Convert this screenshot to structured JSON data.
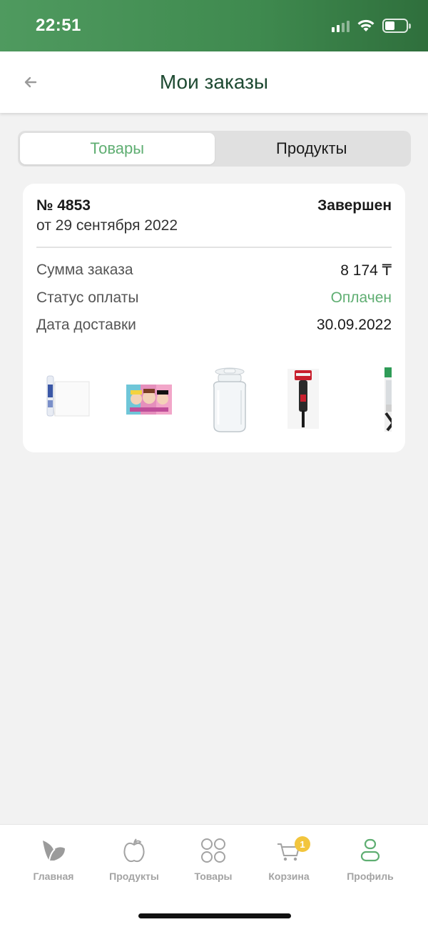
{
  "status_bar": {
    "time": "22:51"
  },
  "header": {
    "title": "Мои заказы",
    "back_icon": "arrow-left-icon"
  },
  "tabs": [
    {
      "label": "Товары",
      "active": true
    },
    {
      "label": "Продукты",
      "active": false
    }
  ],
  "order": {
    "number": "№ 4853",
    "date": "от 29 сентября 2022",
    "status": "Завершен",
    "rows": {
      "sum_label": "Сумма заказа",
      "sum_value": "8 174 ₸",
      "payment_label": "Статус оплаты",
      "payment_value": "Оплачен",
      "delivery_label": "Дата доставки",
      "delivery_value": "30.09.2022"
    },
    "items": [
      "baking-paper-roll",
      "lol-dolls-mat",
      "glass-jar-with-lid",
      "silicone-brush",
      "kitchen-utensil"
    ]
  },
  "bottom_nav": [
    {
      "label": "Главная",
      "icon": "home-leaf-icon",
      "active": false
    },
    {
      "label": "Продукты",
      "icon": "apple-icon",
      "active": false
    },
    {
      "label": "Товары",
      "icon": "grid-circles-icon",
      "active": false
    },
    {
      "label": "Корзина",
      "icon": "cart-icon",
      "active": false,
      "badge": "1"
    },
    {
      "label": "Профиль",
      "icon": "profile-icon",
      "active": true
    }
  ],
  "colors": {
    "accent": "#5fae72",
    "title": "#1e4a32",
    "badge": "#f2c53d"
  }
}
